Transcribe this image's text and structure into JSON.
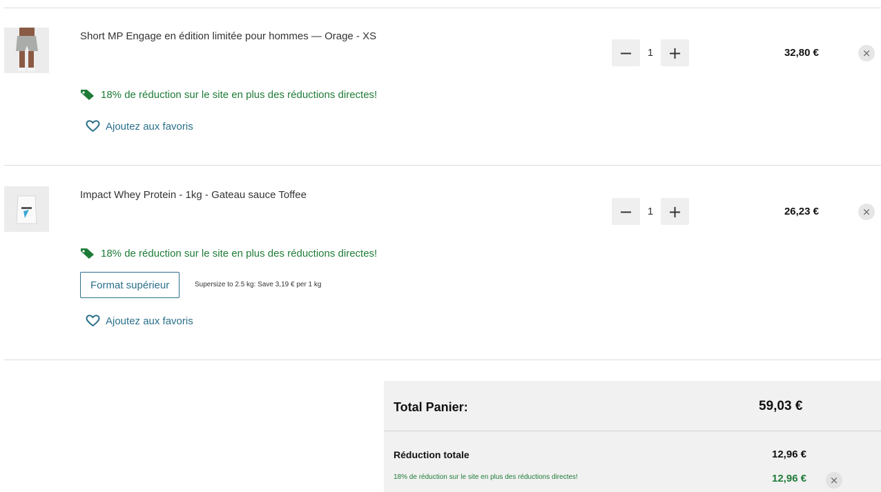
{
  "items": [
    {
      "title": "Short MP Engage en édition limitée pour hommes — Orage - XS",
      "thumb_icon": "shorts-product-image",
      "promo": "18% de réduction sur le site en plus des réductions directes!",
      "quantity": "1",
      "minus_label": "−",
      "plus_label": "+",
      "price": "32,80 €",
      "remove_label": "×",
      "favorite": "Ajoutez aux favoris"
    },
    {
      "title": "Impact Whey Protein - 1kg - Gateau sauce Toffee",
      "thumb_icon": "whey-pouch-product-image",
      "promo": "18% de réduction sur le site en plus des réductions directes!",
      "quantity": "1",
      "minus_label": "−",
      "plus_label": "+",
      "price": "26,23 €",
      "remove_label": "×",
      "upsize_button": "Format supérieur",
      "upsize_text": "Supersize to 2.5 kg: Save 3,19 € per 1 kg",
      "favorite": "Ajoutez aux favoris"
    }
  ],
  "summary": {
    "total_label": "Total Panier:",
    "total_value": "59,03 €",
    "discount_label": "Réduction totale",
    "discount_value": "12,96 €",
    "promo_label": "18% de réduction sur le site en plus des réductions directes!",
    "promo_value": "12,96 €",
    "remove_label": "×"
  },
  "colors": {
    "promo_green": "#1e7b37",
    "link_teal": "#2a6f8a",
    "qty_bg": "#efefef",
    "summary_bg": "#f1f1f1"
  }
}
